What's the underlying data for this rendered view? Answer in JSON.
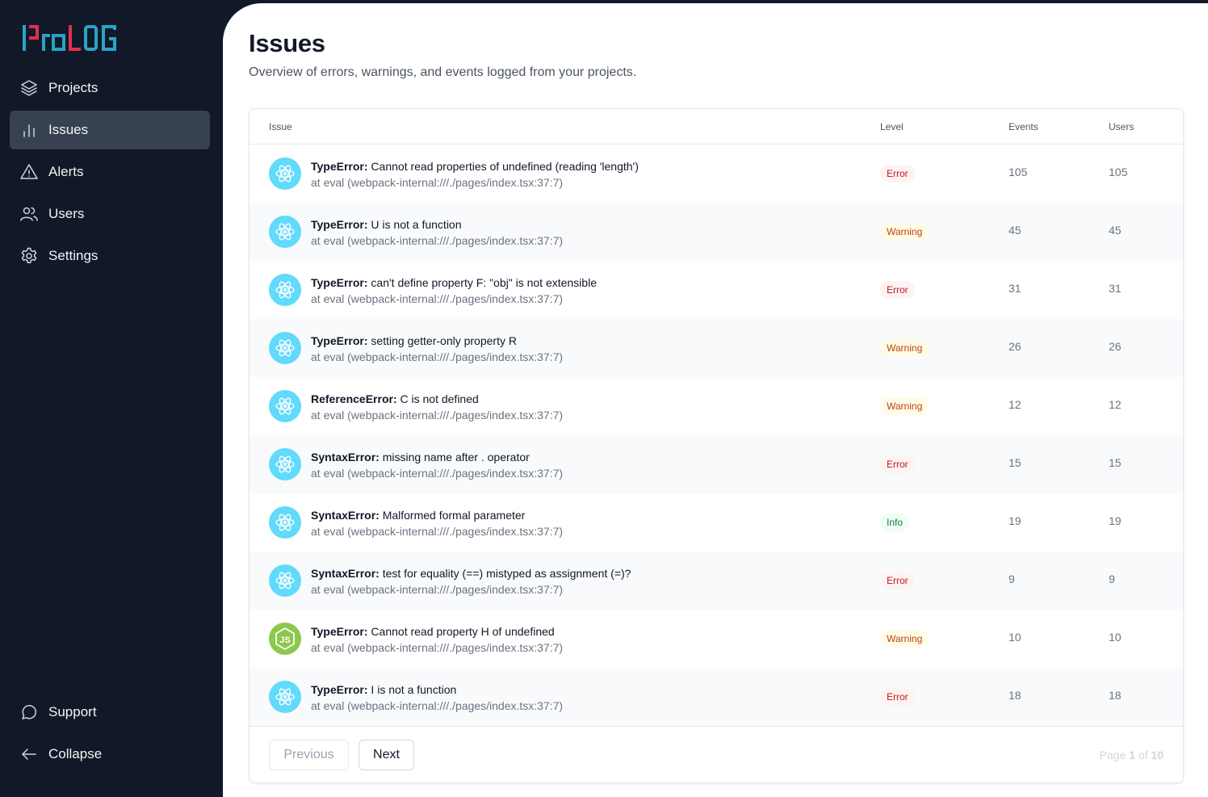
{
  "app": {
    "name": "ProLOG",
    "logo_colors": {
      "primary": "#2aa3c4",
      "accent": "#e0304e"
    }
  },
  "sidebar": {
    "items": [
      {
        "label": "Projects",
        "icon": "layers-icon",
        "active": false
      },
      {
        "label": "Issues",
        "icon": "bar-chart-icon",
        "active": true
      },
      {
        "label": "Alerts",
        "icon": "warning-triangle-icon",
        "active": false
      },
      {
        "label": "Users",
        "icon": "users-icon",
        "active": false
      },
      {
        "label": "Settings",
        "icon": "gear-icon",
        "active": false
      }
    ],
    "bottom_items": [
      {
        "label": "Support",
        "icon": "chat-bubble-icon"
      },
      {
        "label": "Collapse",
        "icon": "arrow-left-icon"
      }
    ]
  },
  "page": {
    "title": "Issues",
    "subtitle": "Overview of errors, warnings, and events logged from your projects."
  },
  "table": {
    "columns": {
      "issue": "Issue",
      "level": "Level",
      "events": "Events",
      "users": "Users"
    },
    "rows": [
      {
        "platform": "react",
        "error_type": "TypeError:",
        "message": " Cannot read properties of undefined (reading 'length')",
        "location": "at eval (webpack-internal:///./pages/index.tsx:37:7)",
        "level": "Error",
        "events": "105",
        "users": "105"
      },
      {
        "platform": "react",
        "error_type": "TypeError:",
        "message": " U is not a function",
        "location": "at eval (webpack-internal:///./pages/index.tsx:37:7)",
        "level": "Warning",
        "events": "45",
        "users": "45"
      },
      {
        "platform": "react",
        "error_type": "TypeError:",
        "message": " can't define property F: \"obj\" is not extensible",
        "location": "at eval (webpack-internal:///./pages/index.tsx:37:7)",
        "level": "Error",
        "events": "31",
        "users": "31"
      },
      {
        "platform": "react",
        "error_type": "TypeError:",
        "message": " setting getter-only property R",
        "location": "at eval (webpack-internal:///./pages/index.tsx:37:7)",
        "level": "Warning",
        "events": "26",
        "users": "26"
      },
      {
        "platform": "react",
        "error_type": "ReferenceError:",
        "message": " C is not defined",
        "location": "at eval (webpack-internal:///./pages/index.tsx:37:7)",
        "level": "Warning",
        "events": "12",
        "users": "12"
      },
      {
        "platform": "react",
        "error_type": "SyntaxError:",
        "message": " missing name after . operator",
        "location": "at eval (webpack-internal:///./pages/index.tsx:37:7)",
        "level": "Error",
        "events": "15",
        "users": "15"
      },
      {
        "platform": "react",
        "error_type": "SyntaxError:",
        "message": " Malformed formal parameter",
        "location": "at eval (webpack-internal:///./pages/index.tsx:37:7)",
        "level": "Info",
        "events": "19",
        "users": "19"
      },
      {
        "platform": "react",
        "error_type": "SyntaxError:",
        "message": " test for equality (==) mistyped as assignment (=)?",
        "location": "at eval (webpack-internal:///./pages/index.tsx:37:7)",
        "level": "Error",
        "events": "9",
        "users": "9"
      },
      {
        "platform": "node",
        "error_type": "TypeError:",
        "message": " Cannot read property H of undefined",
        "location": "at eval (webpack-internal:///./pages/index.tsx:37:7)",
        "level": "Warning",
        "events": "10",
        "users": "10"
      },
      {
        "platform": "react",
        "error_type": "TypeError:",
        "message": " I is not a function",
        "location": "at eval (webpack-internal:///./pages/index.tsx:37:7)",
        "level": "Error",
        "events": "18",
        "users": "18"
      }
    ]
  },
  "pagination": {
    "previous_label": "Previous",
    "next_label": "Next",
    "page_prefix": "Page ",
    "current_page": "1",
    "page_mid": " of ",
    "total_pages": "10"
  }
}
